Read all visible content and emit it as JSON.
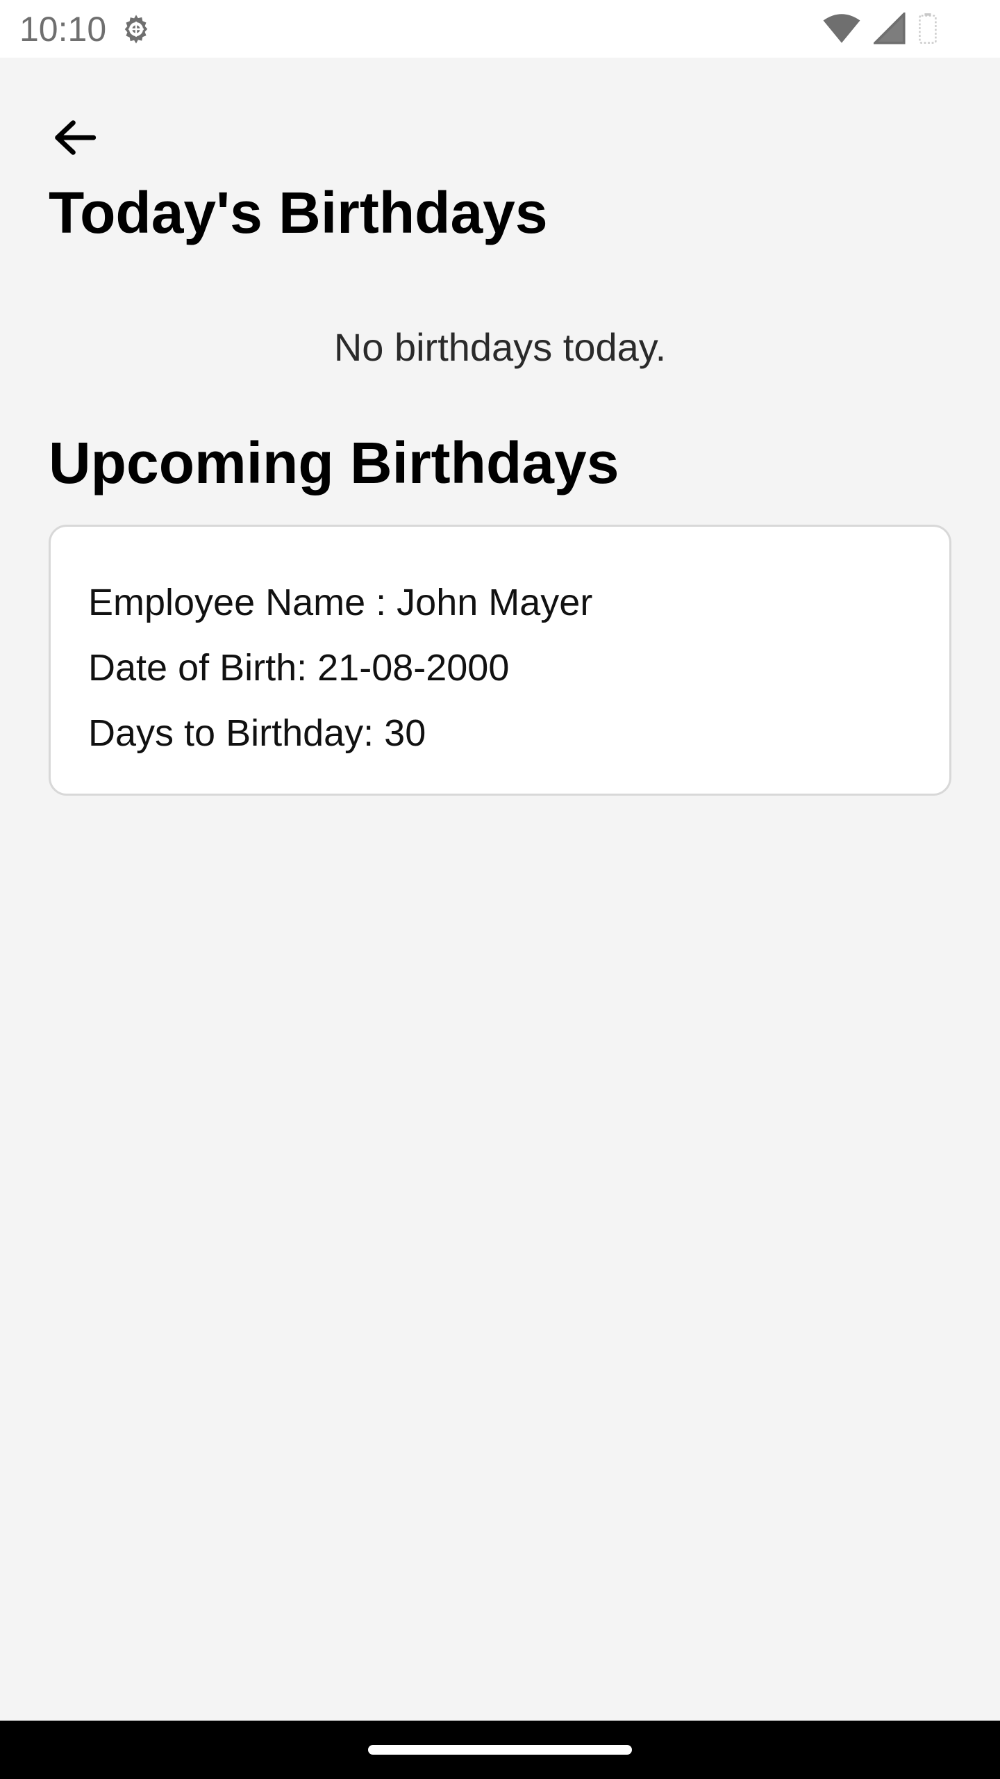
{
  "status_bar": {
    "time": "10:10",
    "icons": [
      "settings-gear-icon",
      "wifi-icon",
      "cell-signal-icon",
      "battery-icon"
    ]
  },
  "header": {
    "back_icon": "arrow-back-icon",
    "title": "Today's Birthdays"
  },
  "today": {
    "empty_message": "No birthdays today."
  },
  "upcoming": {
    "title": "Upcoming Birthdays",
    "items": [
      {
        "name_line": "Employee Name : John Mayer",
        "dob_line": "Date of Birth: 21-08-2000",
        "days_line": "Days to Birthday: 30"
      }
    ]
  },
  "colors": {
    "background": "#f4f4f4",
    "card": "#ffffff",
    "card_border": "#d8d8d8",
    "status_text": "#6f6f6f"
  }
}
